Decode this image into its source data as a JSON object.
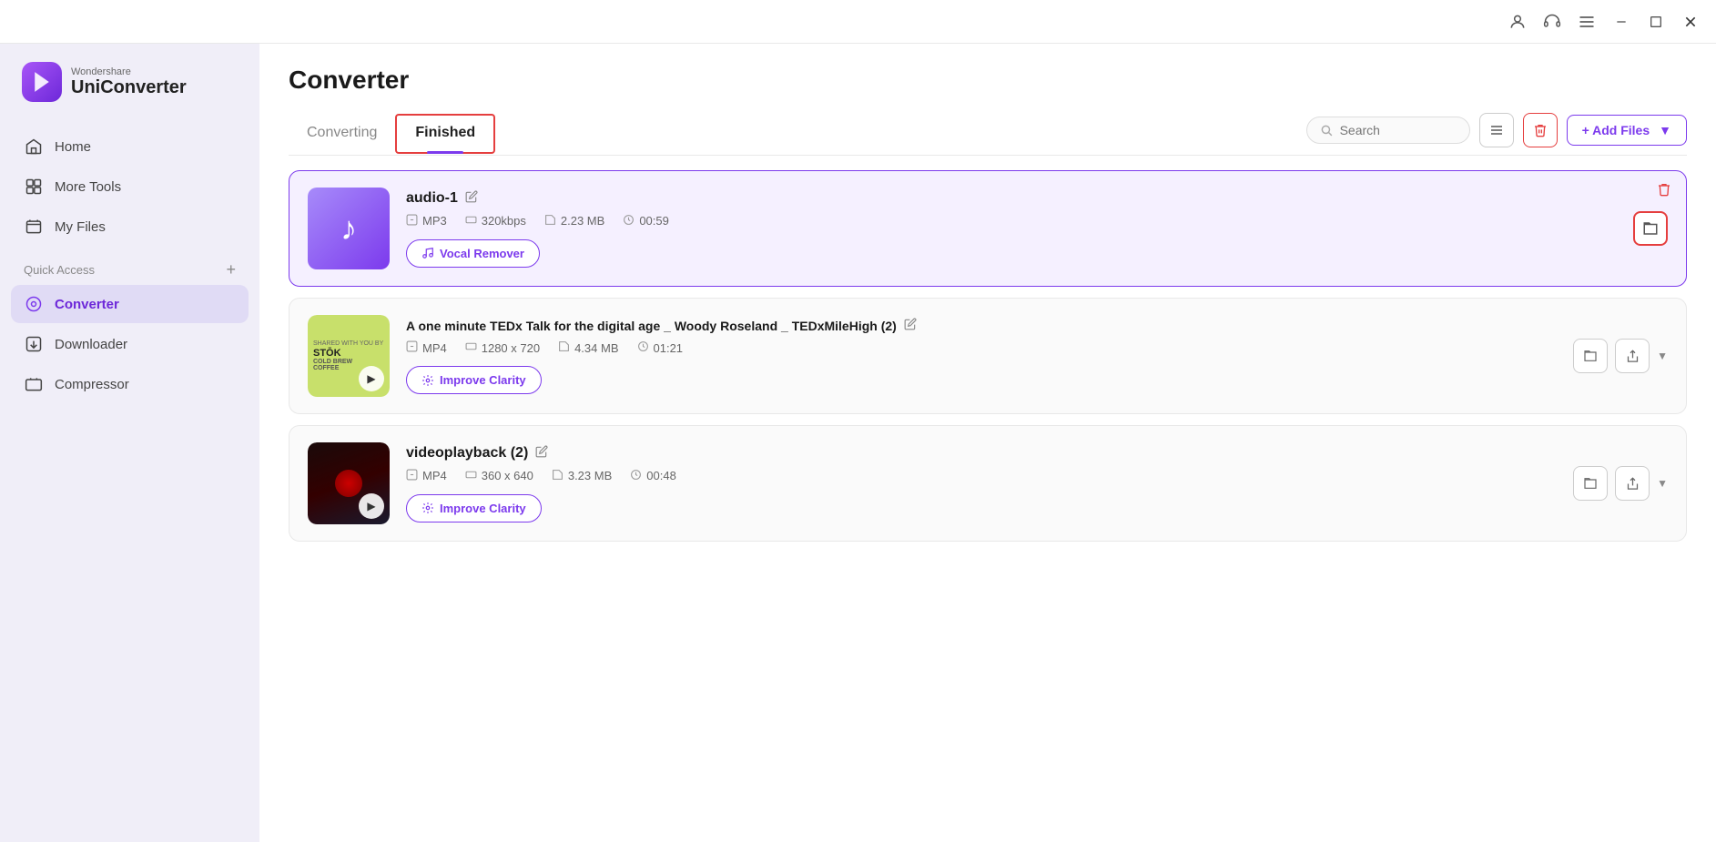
{
  "titlebar": {
    "icons": [
      "user",
      "headset",
      "menu",
      "minimize",
      "maximize",
      "close"
    ]
  },
  "logo": {
    "brand": "Wondershare",
    "name": "UniConverter"
  },
  "sidebar": {
    "nav": [
      {
        "id": "home",
        "label": "Home",
        "icon": "home"
      },
      {
        "id": "more-tools",
        "label": "More Tools",
        "icon": "more-tools"
      },
      {
        "id": "my-files",
        "label": "My Files",
        "icon": "my-files"
      }
    ],
    "quick_access_label": "Quick Access",
    "converter_label": "Converter",
    "downloader_label": "Downloader",
    "compressor_label": "Compressor"
  },
  "main": {
    "title": "Converter",
    "tabs": [
      {
        "id": "converting",
        "label": "Converting",
        "active": false
      },
      {
        "id": "finished",
        "label": "Finished",
        "active": true
      }
    ],
    "search_placeholder": "Search",
    "add_files_label": "+ Add Files",
    "files": [
      {
        "id": "audio-1",
        "name": "audio-1",
        "type": "audio",
        "format": "MP3",
        "bitrate": "320kbps",
        "size": "2.23 MB",
        "duration": "00:59",
        "action_label": "Vocal Remover",
        "action_icon": "vocal",
        "highlighted": true
      },
      {
        "id": "tedx",
        "name": "A one minute TEDx Talk for the digital age _ Woody Roseland _ TEDxMileHigh (2)",
        "type": "video",
        "format": "MP4",
        "resolution": "1280 x 720",
        "size": "4.34 MB",
        "duration": "01:21",
        "action_label": "Improve Clarity",
        "action_icon": "clarity",
        "highlighted": false
      },
      {
        "id": "videoplayback",
        "name": "videoplayback (2)",
        "type": "video",
        "format": "MP4",
        "resolution": "360 x 640",
        "size": "3.23 MB",
        "duration": "00:48",
        "action_label": "Improve Clarity",
        "action_icon": "clarity",
        "highlighted": false
      }
    ]
  },
  "colors": {
    "accent": "#7c3aed",
    "red": "#e53e3e",
    "bg_sidebar": "#f0eef8"
  }
}
